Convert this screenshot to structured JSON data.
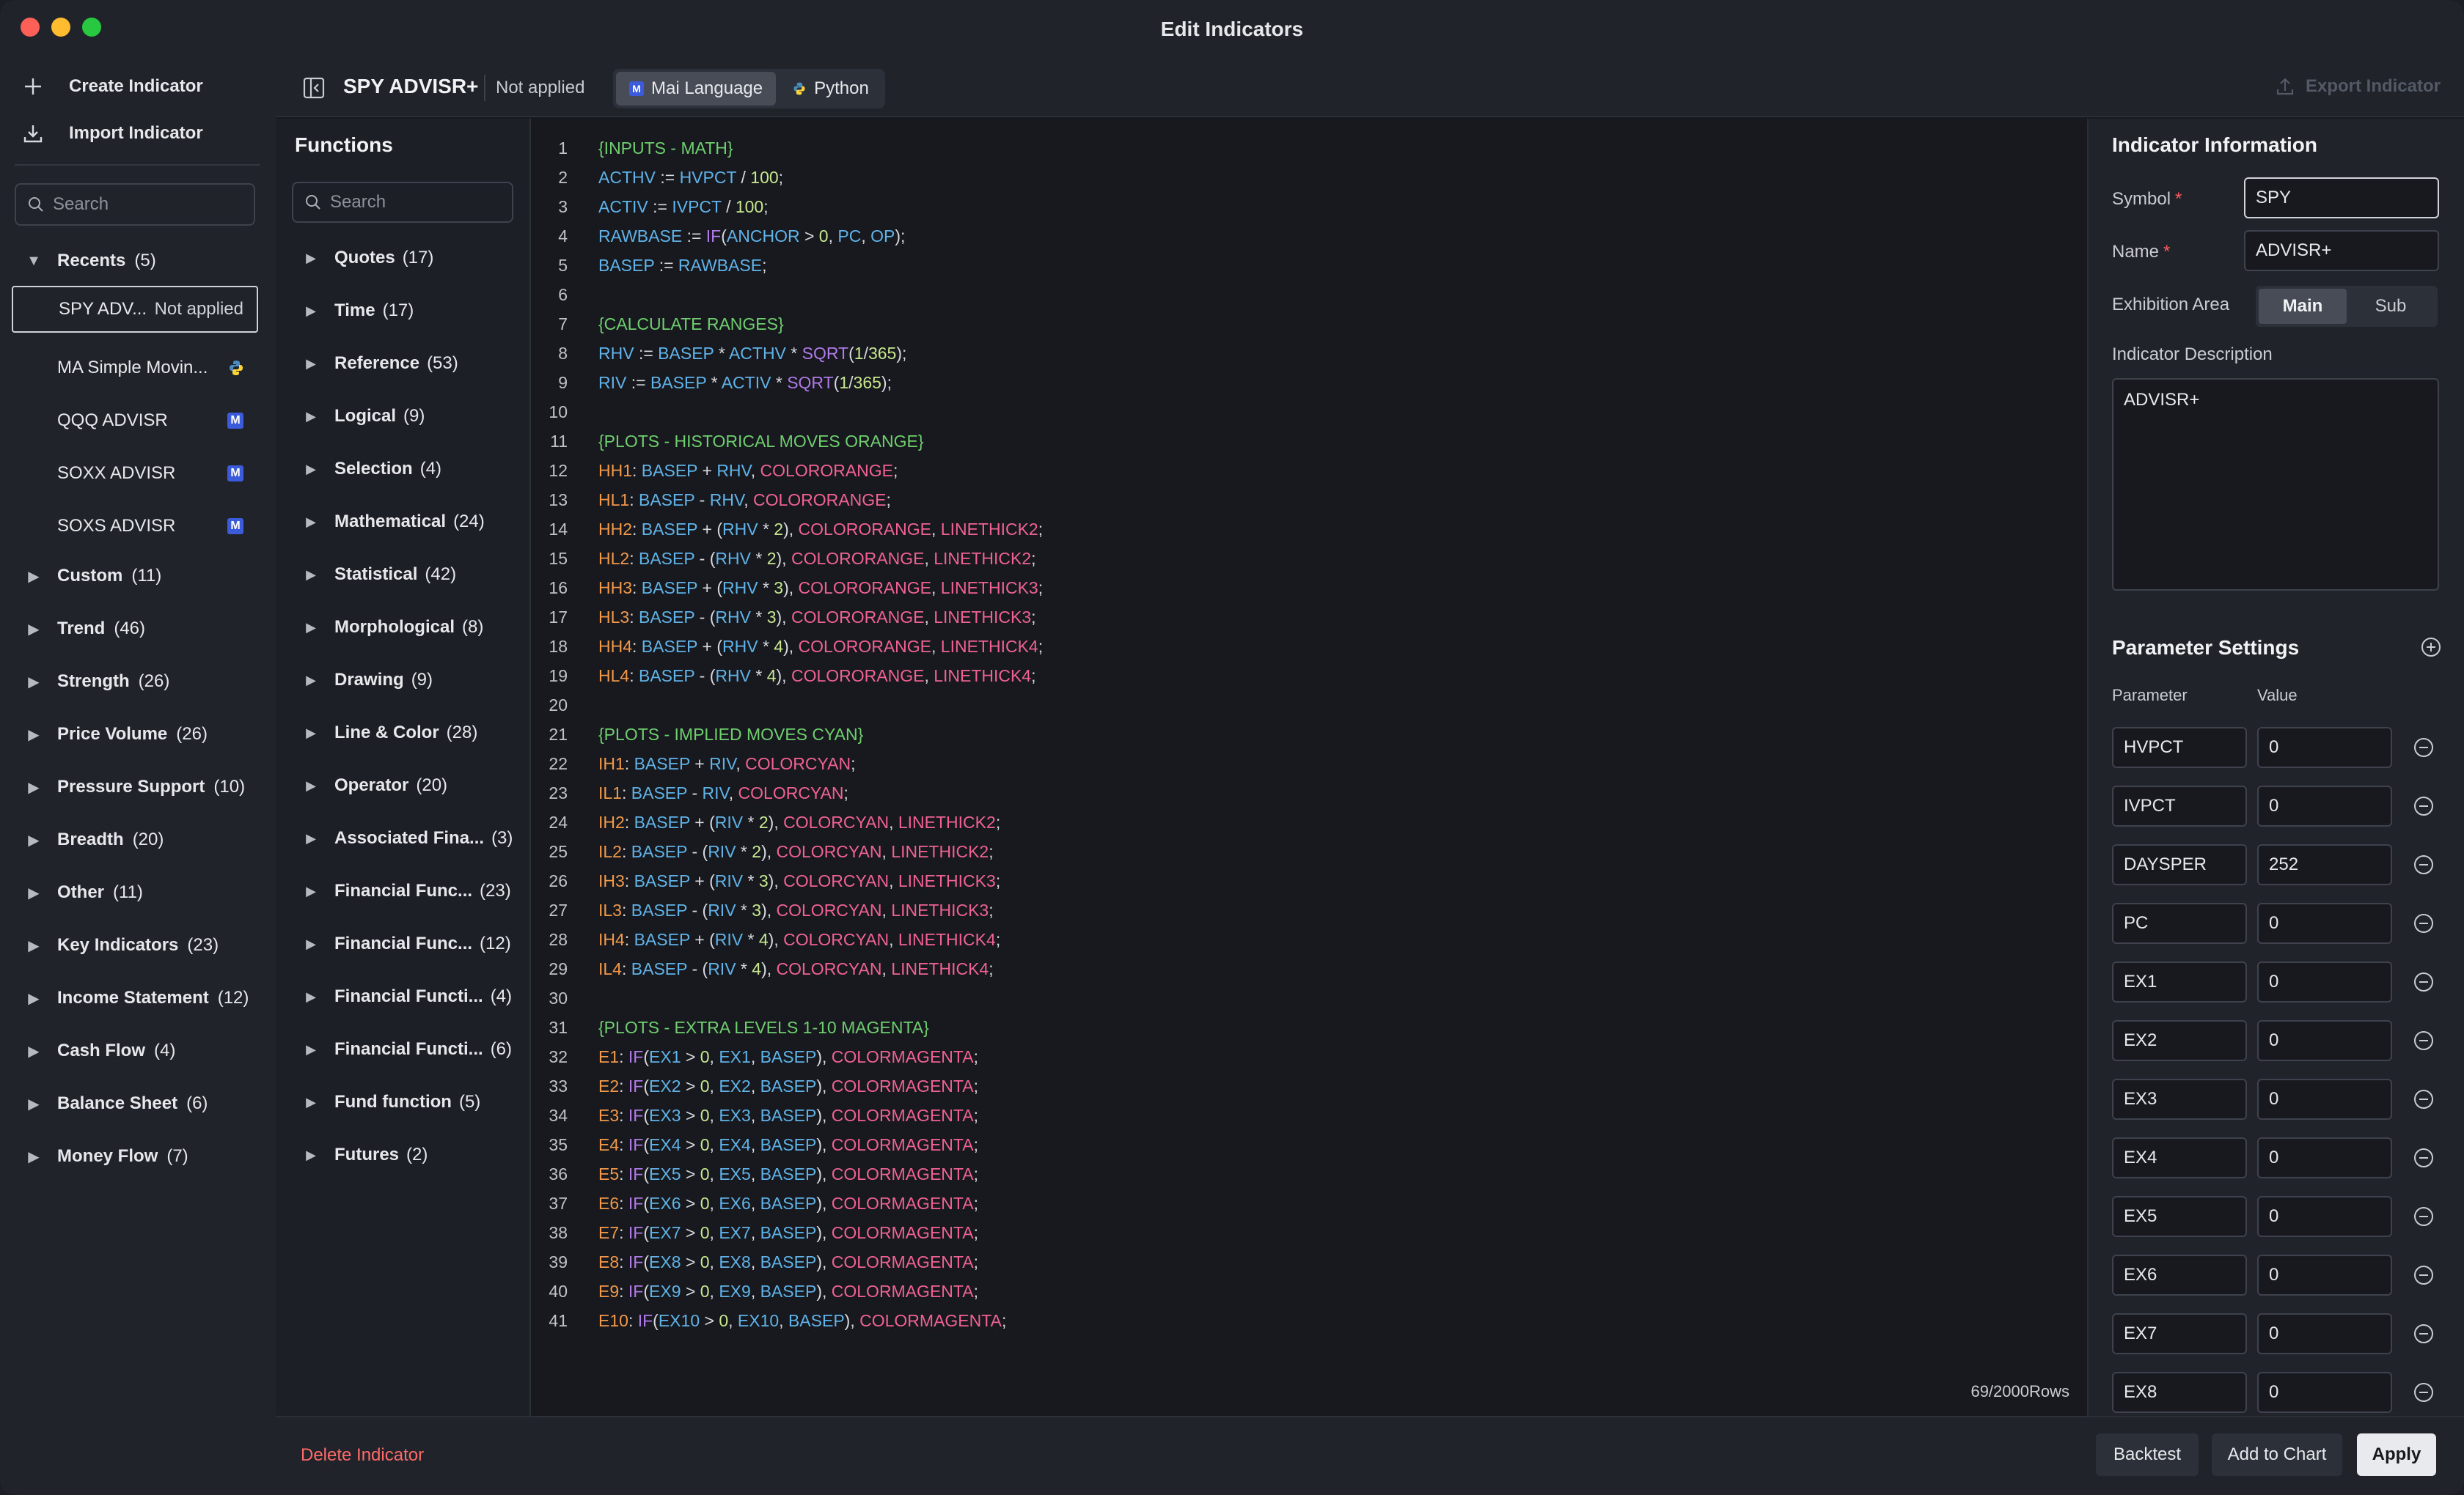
{
  "window": {
    "title": "Edit Indicators"
  },
  "sidebar": {
    "create_label": "Create Indicator",
    "import_label": "Import Indicator",
    "search_placeholder": "Search",
    "recents": {
      "label": "Recents",
      "count": "(5)"
    },
    "recent_items": [
      {
        "name": "SPY ADV...",
        "status": "Not applied",
        "badge": "active"
      },
      {
        "name": "MA Simple Movin...",
        "badge": "python"
      },
      {
        "name": "QQQ ADVISR",
        "badge": "M"
      },
      {
        "name": "SOXX ADVISR",
        "badge": "M"
      },
      {
        "name": "SOXS ADVISR",
        "badge": "M"
      }
    ],
    "categories": [
      {
        "label": "Custom",
        "count": "(11)"
      },
      {
        "label": "Trend",
        "count": "(46)"
      },
      {
        "label": "Strength",
        "count": "(26)"
      },
      {
        "label": "Price Volume",
        "count": "(26)"
      },
      {
        "label": "Pressure Support",
        "count": "(10)"
      },
      {
        "label": "Breadth",
        "count": "(20)"
      },
      {
        "label": "Other",
        "count": "(11)"
      },
      {
        "label": "Key Indicators",
        "count": "(23)"
      },
      {
        "label": "Income Statement",
        "count": "(12)"
      },
      {
        "label": "Cash Flow",
        "count": "(4)"
      },
      {
        "label": "Balance Sheet",
        "count": "(6)"
      },
      {
        "label": "Money Flow",
        "count": "(7)"
      }
    ]
  },
  "topbar": {
    "title": "SPY ADVISR+",
    "status": "Not applied",
    "lang_mai": "Mai Language",
    "lang_python": "Python",
    "export_label": "Export Indicator"
  },
  "functions": {
    "title": "Functions",
    "search_placeholder": "Search",
    "items": [
      {
        "label": "Quotes",
        "count": "(17)"
      },
      {
        "label": "Time",
        "count": "(17)"
      },
      {
        "label": "Reference",
        "count": "(53)"
      },
      {
        "label": "Logical",
        "count": "(9)"
      },
      {
        "label": "Selection",
        "count": "(4)"
      },
      {
        "label": "Mathematical",
        "count": "(24)"
      },
      {
        "label": "Statistical",
        "count": "(42)"
      },
      {
        "label": "Morphological",
        "count": "(8)"
      },
      {
        "label": "Drawing",
        "count": "(9)"
      },
      {
        "label": "Line & Color",
        "count": "(28)"
      },
      {
        "label": "Operator",
        "count": "(20)"
      },
      {
        "label": "Associated Fina...",
        "count": "(3)"
      },
      {
        "label": "Financial Func...",
        "count": "(23)"
      },
      {
        "label": "Financial Func...",
        "count": "(12)"
      },
      {
        "label": "Financial Functi...",
        "count": "(4)"
      },
      {
        "label": "Financial Functi...",
        "count": "(6)"
      },
      {
        "label": "Fund function",
        "count": "(5)"
      },
      {
        "label": "Futures",
        "count": "(2)"
      }
    ]
  },
  "editor": {
    "rows_count": "69/2000Rows",
    "lines": [
      "{INPUTS - MATH}",
      "ACTHV := HVPCT / 100;",
      "ACTIV := IVPCT / 100;",
      "RAWBASE := IF(ANCHOR > 0, PC, OP);",
      "BASEP := RAWBASE;",
      "",
      "{CALCULATE RANGES}",
      "RHV := BASEP * ACTHV * SQRT(1/365);",
      "RIV := BASEP * ACTIV * SQRT(1/365);",
      "",
      "{PLOTS - HISTORICAL MOVES ORANGE}",
      "HH1: BASEP + RHV, COLORORANGE;",
      "HL1: BASEP - RHV, COLORORANGE;",
      "HH2: BASEP + (RHV * 2), COLORORANGE, LINETHICK2;",
      "HL2: BASEP - (RHV * 2), COLORORANGE, LINETHICK2;",
      "HH3: BASEP + (RHV * 3), COLORORANGE, LINETHICK3;",
      "HL3: BASEP - (RHV * 3), COLORORANGE, LINETHICK3;",
      "HH4: BASEP + (RHV * 4), COLORORANGE, LINETHICK4;",
      "HL4: BASEP - (RHV * 4), COLORORANGE, LINETHICK4;",
      "",
      "{PLOTS - IMPLIED MOVES CYAN}",
      "IH1: BASEP + RIV, COLORCYAN;",
      "IL1: BASEP - RIV, COLORCYAN;",
      "IH2: BASEP + (RIV * 2), COLORCYAN, LINETHICK2;",
      "IL2: BASEP - (RIV * 2), COLORCYAN, LINETHICK2;",
      "IH3: BASEP + (RIV * 3), COLORCYAN, LINETHICK3;",
      "IL3: BASEP - (RIV * 3), COLORCYAN, LINETHICK3;",
      "IH4: BASEP + (RIV * 4), COLORCYAN, LINETHICK4;",
      "IL4: BASEP - (RIV * 4), COLORCYAN, LINETHICK4;",
      "",
      "{PLOTS - EXTRA LEVELS 1-10 MAGENTA}",
      "E1: IF(EX1 > 0, EX1, BASEP), COLORMAGENTA;",
      "E2: IF(EX2 > 0, EX2, BASEP), COLORMAGENTA;",
      "E3: IF(EX3 > 0, EX3, BASEP), COLORMAGENTA;",
      "E4: IF(EX4 > 0, EX4, BASEP), COLORMAGENTA;",
      "E5: IF(EX5 > 0, EX5, BASEP), COLORMAGENTA;",
      "E6: IF(EX6 > 0, EX6, BASEP), COLORMAGENTA;",
      "E7: IF(EX7 > 0, EX7, BASEP), COLORMAGENTA;",
      "E8: IF(EX8 > 0, EX8, BASEP), COLORMAGENTA;",
      "E9: IF(EX9 > 0, EX9, BASEP), COLORMAGENTA;",
      "E10: IF(EX10 > 0, EX10, BASEP), COLORMAGENTA;"
    ]
  },
  "info": {
    "title": "Indicator Information",
    "symbol_label": "Symbol",
    "symbol_value": "SPY",
    "name_label": "Name",
    "name_value": "ADVISR+",
    "exhibition_label": "Exhibition Area",
    "exhibition_main": "Main",
    "exhibition_sub": "Sub",
    "description_label": "Indicator Description",
    "description_value": "ADVISR+"
  },
  "params": {
    "title": "Parameter Settings",
    "col_param": "Parameter",
    "col_value": "Value",
    "rows": [
      {
        "name": "HVPCT",
        "value": "0"
      },
      {
        "name": "IVPCT",
        "value": "0"
      },
      {
        "name": "DAYSPER",
        "value": "252"
      },
      {
        "name": "PC",
        "value": "0"
      },
      {
        "name": "EX1",
        "value": "0"
      },
      {
        "name": "EX2",
        "value": "0"
      },
      {
        "name": "EX3",
        "value": "0"
      },
      {
        "name": "EX4",
        "value": "0"
      },
      {
        "name": "EX5",
        "value": "0"
      },
      {
        "name": "EX6",
        "value": "0"
      },
      {
        "name": "EX7",
        "value": "0"
      },
      {
        "name": "EX8",
        "value": "0"
      }
    ]
  },
  "bottom": {
    "delete_label": "Delete Indicator",
    "backtest_label": "Backtest",
    "add_to_chart_label": "Add to Chart",
    "apply_label": "Apply"
  },
  "colors": {
    "comment": "#6fcf6f",
    "variable": "#5fb3e8",
    "plot_name": "#f2994a",
    "function": "#b07ae8",
    "number": "#c8e88f",
    "color_const": "#f06292",
    "danger": "#ff6b6b",
    "accent_m": "#3b5bdb"
  }
}
